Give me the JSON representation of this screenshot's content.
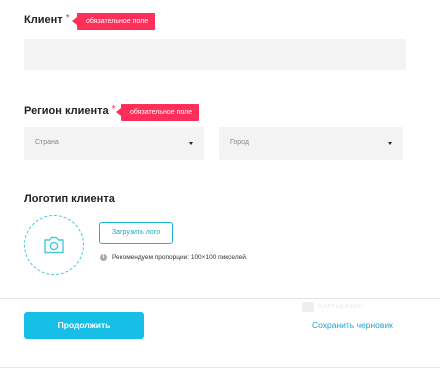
{
  "client": {
    "label": "Клиент",
    "required_mark": "*",
    "badge": "обязательное поле",
    "value": ""
  },
  "region": {
    "label": "Регион клиента",
    "required_mark": "*",
    "badge": "обязательное поле",
    "country_placeholder": "Страна",
    "city_placeholder": "Город"
  },
  "logo": {
    "label": "Логотип клиента",
    "upload_button": "Загрузить лого",
    "info_glyph": "i",
    "hint": "Рекомендуем пропорции: 100×100 пикселей.",
    "icon": "camera-icon"
  },
  "actions": {
    "continue": "Продолжить",
    "save_draft": "Сохранить черновик"
  },
  "watermark": "ПАРТНЕРКИН",
  "colors": {
    "accent": "#17bfe6",
    "required": "#ff2f5a",
    "link": "#1aa9d6",
    "field_bg": "#f3f3f3"
  }
}
